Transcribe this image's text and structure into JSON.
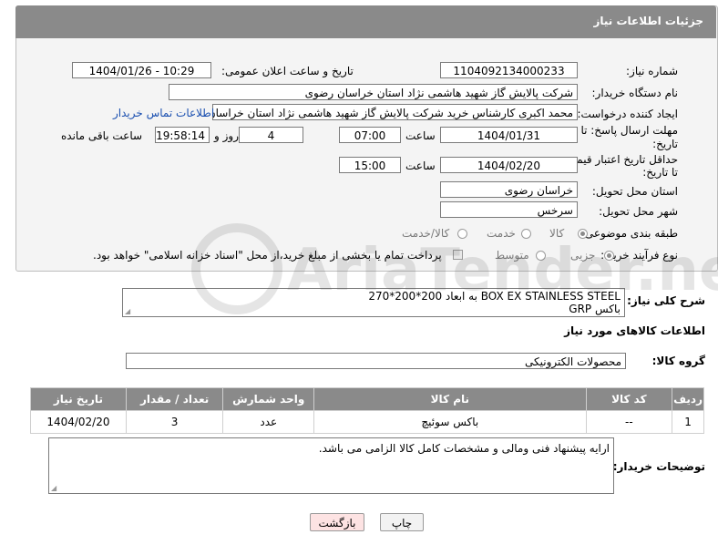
{
  "header": {
    "title": "جزئیات اطلاعات نیاز"
  },
  "form": {
    "need_number_label": "شماره نیاز:",
    "need_number": "1104092134000233",
    "announce_label": "تاریخ و ساعت اعلان عمومی:",
    "announce_value": "1404/01/26 - 10:29",
    "buyer_label": "نام دستگاه خریدار:",
    "buyer_value": "شرکت پالایش گاز شهید هاشمی نژاد   استان خراسان رضوی",
    "creator_label": "ایجاد کننده درخواست:",
    "creator_value": "محمد اکبری کارشناس خرید شرکت پالایش گاز شهید هاشمی نژاد   استان خراسان رضوی",
    "contact_link": "اطلاعات تماس خریدار",
    "deadline_label_1": "مهلت ارسال پاسخ: تا",
    "deadline_label_2": "تاریخ:",
    "deadline_date": "1404/01/31",
    "time_label": "ساعت",
    "deadline_time": "07:00",
    "days_value": "4",
    "days_label": "روز و",
    "remaining_value": "19:58:14",
    "remaining_label": "ساعت باقی مانده",
    "validity_label_1": "حداقل تاریخ اعتبار قیمت:",
    "validity_label_2": "تا تاریخ:",
    "validity_date": "1404/02/20",
    "validity_time": "15:00",
    "province_label": "استان محل تحویل:",
    "province_value": "خراسان رضوی",
    "city_label": "شهر محل تحویل:",
    "city_value": "سرخس",
    "category_label": "طبقه بندی موضوعی:",
    "category_options": [
      "کالا",
      "خدمت",
      "کالا/خدمت"
    ],
    "process_label": "نوع فرآیند خرید :",
    "process_options": [
      "جزیی",
      "متوسط"
    ],
    "payment_note": "پرداخت تمام یا بخشی از مبلغ خرید،از محل \"اسناد خزانه اسلامی\" خواهد بود."
  },
  "summary": {
    "label": "شرح کلی نیاز:",
    "line1": "BOX EX STAINLESS STEEL  به ابعاد 200*200*270",
    "line2": "باکس GRP"
  },
  "goods": {
    "section_title": "اطلاعات کالاهای مورد نیاز",
    "group_label": "گروه کالا:",
    "group_value": "محصولات الکترونیکی",
    "columns": [
      "ردیف",
      "کد کالا",
      "نام کالا",
      "واحد شمارش",
      "تعداد / مقدار",
      "تاریخ نیاز"
    ],
    "rows": [
      {
        "index": "1",
        "code": "--",
        "name": "باکس سوئیچ",
        "unit": "عدد",
        "qty": "3",
        "date": "1404/02/20"
      }
    ]
  },
  "notes": {
    "label": "توضیحات خریدار:",
    "text": "ارایه پیشنهاد فنی ومالی و مشخصات کامل کالا الزامی می باشد."
  },
  "buttons": {
    "print": "چاپ",
    "back": "بازگشت"
  },
  "watermark": {
    "text": "AriaTender.neT"
  },
  "colors": {
    "header_bg": "#8a8a8a",
    "link": "#1a4fb0",
    "back_bg": "#fde3e3"
  }
}
